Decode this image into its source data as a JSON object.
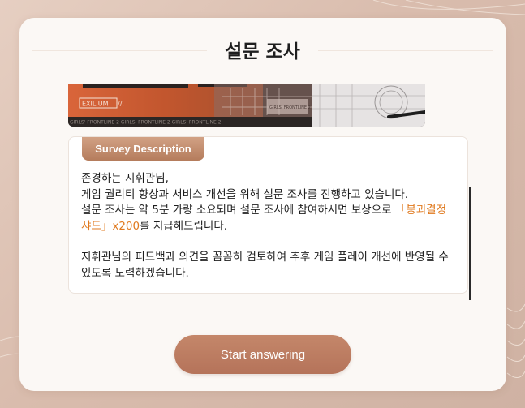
{
  "survey": {
    "title": "설문 조사",
    "banner": {
      "brand_text": "EXILIUM",
      "ticker_text": "GIRLS' FRONTLINE 2   GIRLS' FRONTLINE 2   GIRLS' FRONTLINE 2",
      "sign_text": "GIRLS' FRONTLINE 2"
    },
    "description": {
      "tab_label": "Survey Description",
      "greeting": "존경하는 지휘관님,",
      "line1": "게임 퀄리티 향상과 서비스 개선을 위해 설문 조사를 진행하고 있습니다.",
      "line2_a": "설문 조사는 약 5분 가량 소요되며 설문 조사에 참여하시면 보상으로 ",
      "reward_text": "「붕괴결정 샤드」x200",
      "line2_b": "를 지급해드립니다.",
      "line3": "지휘관님의 피드백과 의견을 꼼꼼히 검토하여 추후 게임 플레이 개선에 반영될 수 있도록 노력하겠습니다."
    },
    "start_button_label": "Start answering"
  },
  "colors": {
    "accent": "#b97a5d",
    "reward": "#e07a1f",
    "card": "#fbf8f5"
  }
}
